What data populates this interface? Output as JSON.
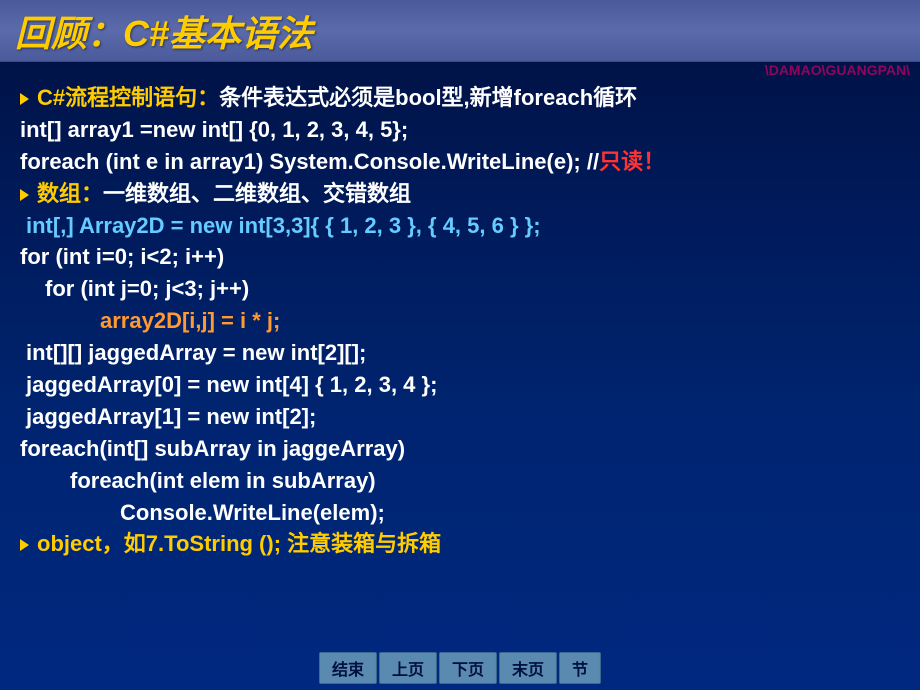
{
  "title": "回顾：C#基本语法",
  "decoration": "\\DAMAO\\GUANGPAN\\",
  "bullets": {
    "b1_prefix": "C#流程控制语句：",
    "b1_rest": "条件表达式必须是bool型,新增foreach循环",
    "b2_prefix": "数组：",
    "b2_rest": "一维数组、二维数组、交错数组",
    "b3_prefix": "object",
    "b3_mid": "，如7.ToString ();",
    "b3_end": "注意装箱与拆箱"
  },
  "code": {
    "l1": "int[] array1 =new int[] {0, 1, 2, 3, 4, 5};",
    "l2a": "foreach (int e in array1)    System.Console.WriteLine(e); //",
    "l2b": "只读！",
    "l3": "int[,] Array2D = new int[3,3]{ { 1, 2, 3 }, { 4, 5, 6 } };",
    "l4": "for (int i=0; i<2; i++)",
    "l5": "for (int j=0; j<3; j++)",
    "l6": "array2D[i,j] = i * j;",
    "l7": "int[][] jaggedArray = new int[2][];",
    "l8": "jaggedArray[0] = new int[4] { 1, 2, 3, 4 };",
    "l9": "jaggedArray[1] = new int[2];",
    "l10": "foreach(int[] subArray in jaggeArray)",
    "l11": "foreach(int elem in subArray)",
    "l12": "Console.WriteLine(elem);"
  },
  "nav": {
    "end": "结束",
    "prev": "上页",
    "next": "下页",
    "last": "末页",
    "section": "节"
  }
}
